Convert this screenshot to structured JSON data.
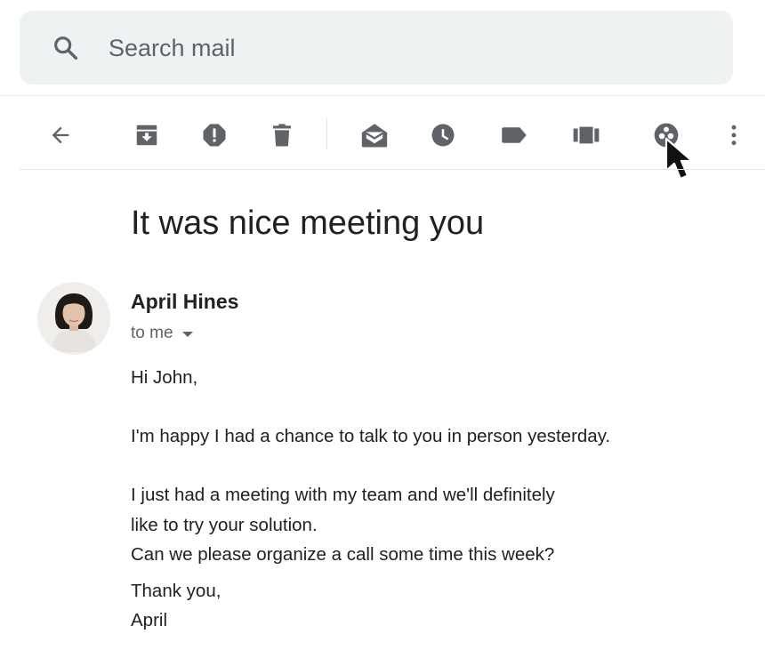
{
  "search": {
    "placeholder": "Search mail",
    "value": ""
  },
  "toolbar": {
    "buttons": [
      {
        "name": "back",
        "icon": "arrow-left-icon"
      },
      {
        "name": "archive",
        "icon": "archive-icon"
      },
      {
        "name": "report-spam",
        "icon": "report-spam-icon"
      },
      {
        "name": "delete",
        "icon": "trash-icon"
      },
      {
        "name": "mark-unread",
        "icon": "mark-unread-icon"
      },
      {
        "name": "snooze",
        "icon": "clock-icon"
      },
      {
        "name": "label",
        "icon": "label-icon"
      },
      {
        "name": "move-to",
        "icon": "move-to-icon"
      },
      {
        "name": "addon",
        "icon": "addon-icon"
      },
      {
        "name": "more",
        "icon": "more-vert-icon"
      }
    ]
  },
  "email": {
    "subject": "It was nice meeting you",
    "sender": "April Hines",
    "recipients": "to me",
    "body": {
      "greeting": "Hi John,",
      "line1": "I'm happy I had a chance to talk to you in person yesterday.",
      "line2": "I just had a meeting with my team and we'll definitely",
      "line3": "like to try your solution.",
      "line4": "Can we please organize a call some time this week?",
      "closing": "Thank you,",
      "signature": "April"
    }
  },
  "colors": {
    "icon": "#5f6368",
    "search_bg": "#eef2f3",
    "text": "#202124"
  }
}
